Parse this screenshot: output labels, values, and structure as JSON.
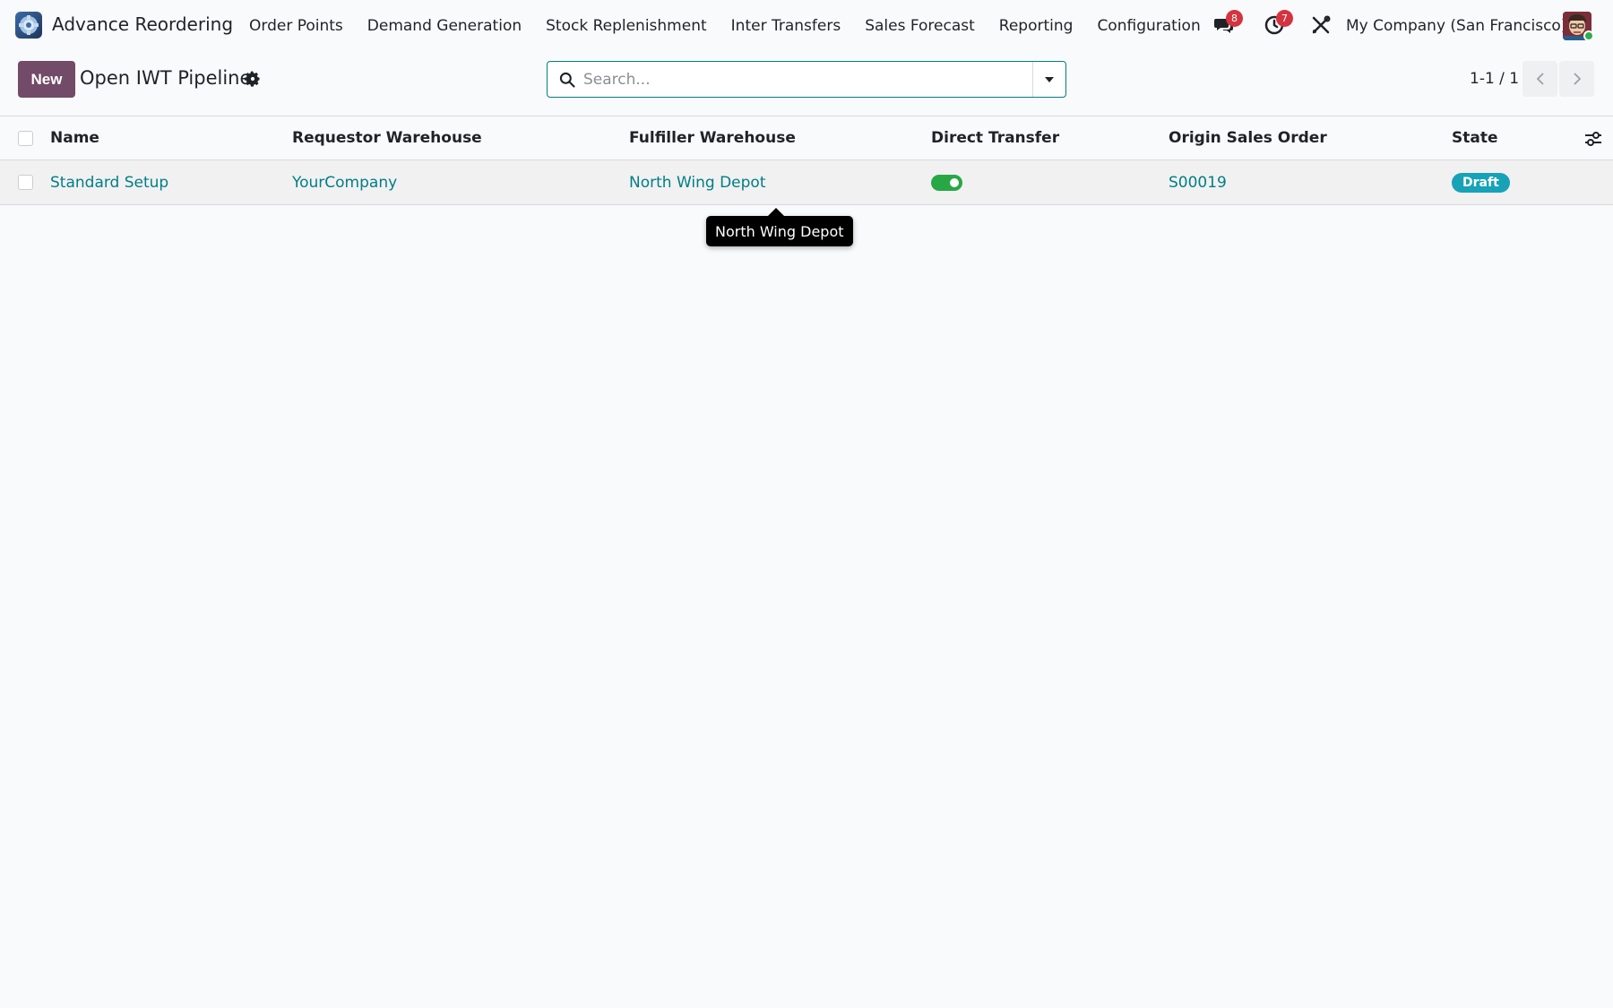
{
  "app": {
    "name": "Advance Reordering",
    "logo_icon": "app-logo-icon"
  },
  "nav": {
    "items": [
      {
        "label": "Order Points"
      },
      {
        "label": "Demand Generation"
      },
      {
        "label": "Stock Replenishment"
      },
      {
        "label": "Inter Transfers"
      },
      {
        "label": "Sales Forecast"
      },
      {
        "label": "Reporting"
      },
      {
        "label": "Configuration"
      }
    ]
  },
  "systray": {
    "messages_count": "8",
    "activities_count": "7",
    "company": "My Company (San Francisco)",
    "online_status_color": "#2dae4e"
  },
  "control_panel": {
    "new_label": "New",
    "view_title": "Open IWT Pipeline",
    "search_placeholder": "Search...",
    "pager_value": "1-1 / 1"
  },
  "table": {
    "headers": {
      "name": "Name",
      "requestor": "Requestor Warehouse",
      "fulfiller": "Fulfiller Warehouse",
      "direct": "Direct Transfer",
      "origin": "Origin Sales Order",
      "state": "State"
    },
    "rows": [
      {
        "name": "Standard Setup",
        "requestor": "YourCompany",
        "fulfiller": "North Wing Depot",
        "direct_transfer": true,
        "origin": "S00019",
        "state": "Draft"
      }
    ]
  },
  "tooltip": {
    "text": "North Wing Depot"
  },
  "colors": {
    "brand": "#714b67",
    "link": "#017e84",
    "badge": "#d4343f",
    "toggle_on": "#28a745",
    "state_draft": "#17a2b8"
  }
}
